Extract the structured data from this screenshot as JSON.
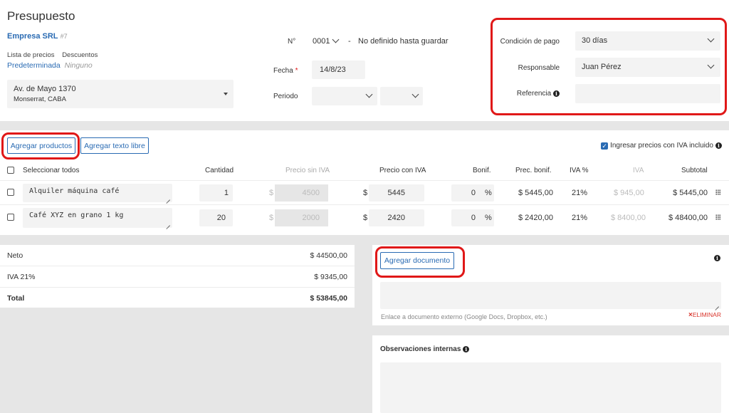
{
  "header": {
    "title": "Presupuesto",
    "client_name": "Empresa SRL",
    "client_id": "#7",
    "price_list_label": "Lista de precios",
    "discounts_label": "Descuentos",
    "price_list_value": "Predeterminada",
    "discounts_value": "Ninguno",
    "address_line1": "Av. de Mayo 1370",
    "address_line2": "Monserrat, CABA",
    "number_label": "N°",
    "number_value": "0001",
    "number_dash": "-",
    "number_note": "No definido hasta guardar",
    "date_label": "Fecha",
    "date_required": "*",
    "date_value": "14/8/23",
    "period_label": "Periodo",
    "payment_label": "Condición de pago",
    "payment_value": "30 días",
    "responsible_label": "Responsable",
    "responsible_value": "Juan Pérez",
    "reference_label": "Referencia",
    "reference_value": ""
  },
  "products": {
    "add_products_label": "Agregar productos",
    "add_free_text_label": "Agregar texto libre",
    "iva_included_label": "Ingresar precios con IVA incluido",
    "iva_included_checked": true,
    "columns": {
      "select_all": "Seleccionar todos",
      "quantity": "Cantidad",
      "price_no_iva": "Precio sin IVA",
      "price_with_iva": "Precio con IVA",
      "discount": "Bonif.",
      "disc_price": "Prec. bonif.",
      "iva_pct": "IVA %",
      "iva": "IVA",
      "subtotal": "Subtotal"
    },
    "rows": [
      {
        "description": "Alquiler máquina café",
        "quantity": "1",
        "currency": "$",
        "price_no_iva": "4500",
        "price_with_iva": "5445",
        "discount": "0",
        "pct": "%",
        "disc_price": "$ 5445,00",
        "iva_pct": "21%",
        "iva": "$ 945,00",
        "subtotal": "$ 5445,00"
      },
      {
        "description": "Café XYZ en grano 1 kg",
        "quantity": "20",
        "currency": "$",
        "price_no_iva": "2000",
        "price_with_iva": "2420",
        "discount": "0",
        "pct": "%",
        "disc_price": "$ 2420,00",
        "iva_pct": "21%",
        "iva": "$ 8400,00",
        "subtotal": "$ 48400,00"
      }
    ]
  },
  "totals": {
    "net_label": "Neto",
    "net_value": "$ 44500,00",
    "iva_label": "IVA 21%",
    "iva_value": "$ 9345,00",
    "total_label": "Total",
    "total_value": "$ 53845,00"
  },
  "documents": {
    "add_document_label": "Agregar documento",
    "link_placeholder": "Enlace a documento externo (Google Docs, Dropbox, etc.)",
    "delete_label": "ELIMINAR",
    "delete_icon": "×"
  },
  "notes": {
    "label": "Observaciones internas"
  },
  "colors": {
    "accent": "#2a6bb3",
    "highlight": "#e01818",
    "delete": "#d9342b"
  }
}
